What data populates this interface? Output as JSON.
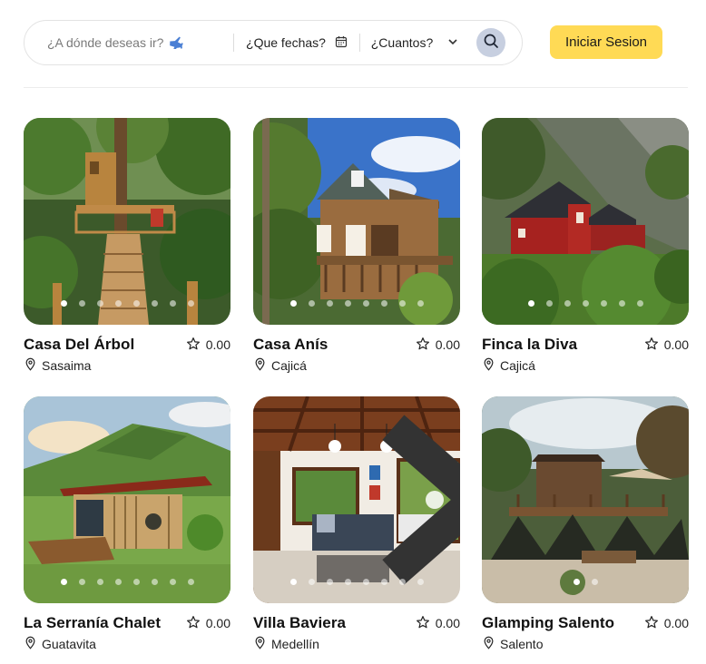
{
  "search": {
    "where_placeholder": "¿A dónde deseas ir?",
    "dates_label": "¿Que fechas?",
    "guests_label": "¿Cuantos?"
  },
  "header": {
    "login_label": "Iniciar Sesion"
  },
  "icons": {
    "plane": "airplane-icon",
    "calendar": "calendar-icon",
    "chevron": "chevron-down-icon",
    "search": "search-icon",
    "star": "star-outline-icon",
    "pin": "location-pin-icon",
    "next": "chevron-right-icon"
  },
  "colors": {
    "login_button": "#ffda55",
    "search_button": "#c7cfe0"
  },
  "listings": [
    {
      "name": "Casa Del Árbol",
      "rating": "0.00",
      "location": "Sasaima",
      "photos": 8,
      "active_photo": 1
    },
    {
      "name": "Casa Anís",
      "rating": "0.00",
      "location": "Cajicá",
      "photos": 8,
      "active_photo": 1
    },
    {
      "name": "Finca la Diva",
      "rating": "0.00",
      "location": "Cajicá",
      "photos": 7,
      "active_photo": 1
    },
    {
      "name": "La Serranía Chalet",
      "rating": "0.00",
      "location": "Guatavita",
      "photos": 8,
      "active_photo": 1
    },
    {
      "name": "Villa Baviera",
      "rating": "0.00",
      "location": "Medellín",
      "photos": 8,
      "active_photo": 1
    },
    {
      "name": "Glamping Salento",
      "rating": "0.00",
      "location": "Salento",
      "photos": 2,
      "active_photo": 1
    }
  ]
}
